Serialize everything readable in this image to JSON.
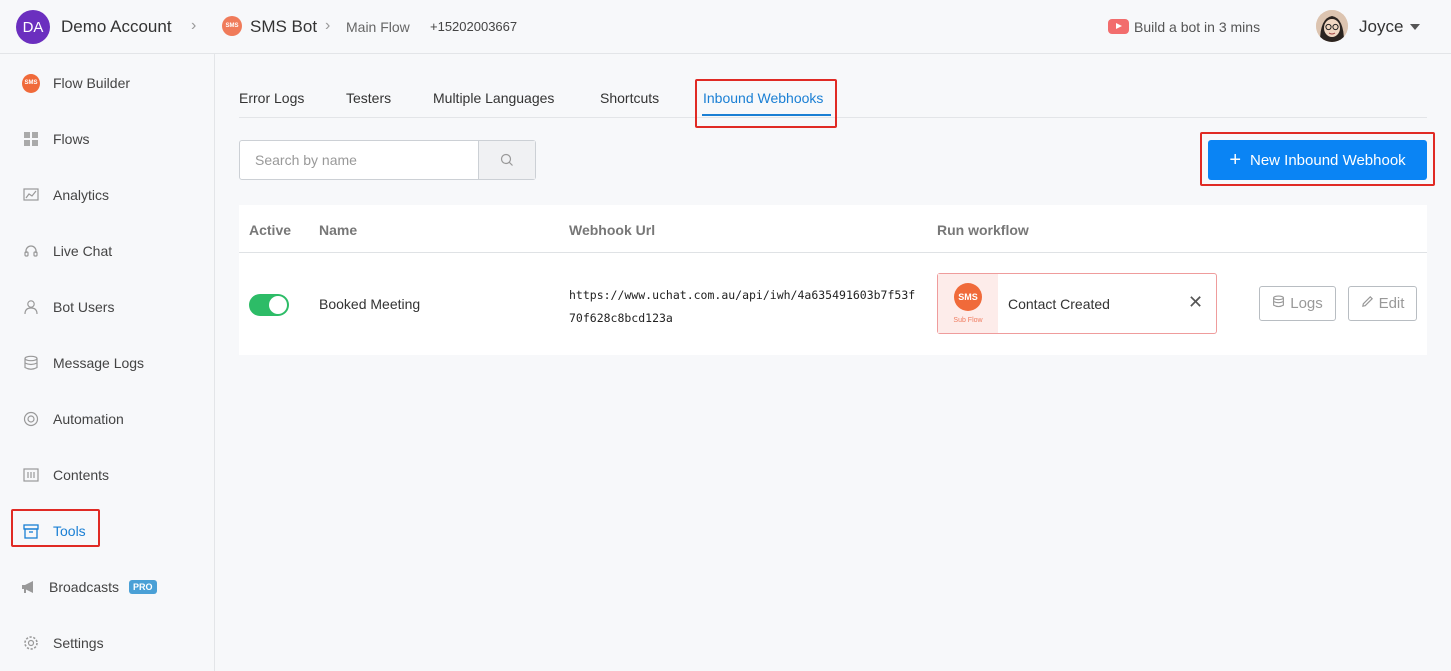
{
  "header": {
    "account_initials": "DA",
    "account_name": "Demo Account",
    "bot_icon_text": "SMS",
    "bot_name": "SMS Bot",
    "flow_name": "Main Flow",
    "phone": "+15202003667",
    "build_bot_label": "Build a bot in 3 mins",
    "user_name": "Joyce"
  },
  "sidebar": {
    "items": [
      {
        "label": "Flow Builder",
        "icon": "sms-icon"
      },
      {
        "label": "Flows",
        "icon": "grid-icon"
      },
      {
        "label": "Analytics",
        "icon": "chart-icon"
      },
      {
        "label": "Live Chat",
        "icon": "headset-icon"
      },
      {
        "label": "Bot Users",
        "icon": "user-icon"
      },
      {
        "label": "Message Logs",
        "icon": "database-icon"
      },
      {
        "label": "Automation",
        "icon": "lifebuoy-icon"
      },
      {
        "label": "Contents",
        "icon": "contents-icon"
      },
      {
        "label": "Tools",
        "icon": "archive-box-icon"
      },
      {
        "label": "Broadcasts",
        "icon": "megaphone-icon",
        "badge": "PRO"
      },
      {
        "label": "Settings",
        "icon": "gear-icon"
      }
    ],
    "active": "Tools"
  },
  "tabs": [
    {
      "label": "Error Logs"
    },
    {
      "label": "Testers"
    },
    {
      "label": "Multiple Languages"
    },
    {
      "label": "Shortcuts"
    },
    {
      "label": "Inbound Webhooks"
    }
  ],
  "active_tab": "Inbound Webhooks",
  "search": {
    "placeholder": "Search by name"
  },
  "new_button_label": "New Inbound Webhook",
  "table": {
    "columns": [
      "Active",
      "Name",
      "Webhook Url",
      "Run workflow"
    ],
    "rows": [
      {
        "active": true,
        "name": "Booked Meeting",
        "url": "https://www.uchat.com.au/api/iwh/4a635491603b7f53f70f628c8bcd123a",
        "workflow": {
          "icon_text": "SMS",
          "sub_label": "Sub Flow",
          "title": "Contact Created"
        },
        "logs_label": "Logs",
        "edit_label": "Edit"
      }
    ]
  },
  "colors": {
    "accent": "#0a84f4",
    "highlight": "#e02a24",
    "toggle_on": "#2dbc67"
  }
}
